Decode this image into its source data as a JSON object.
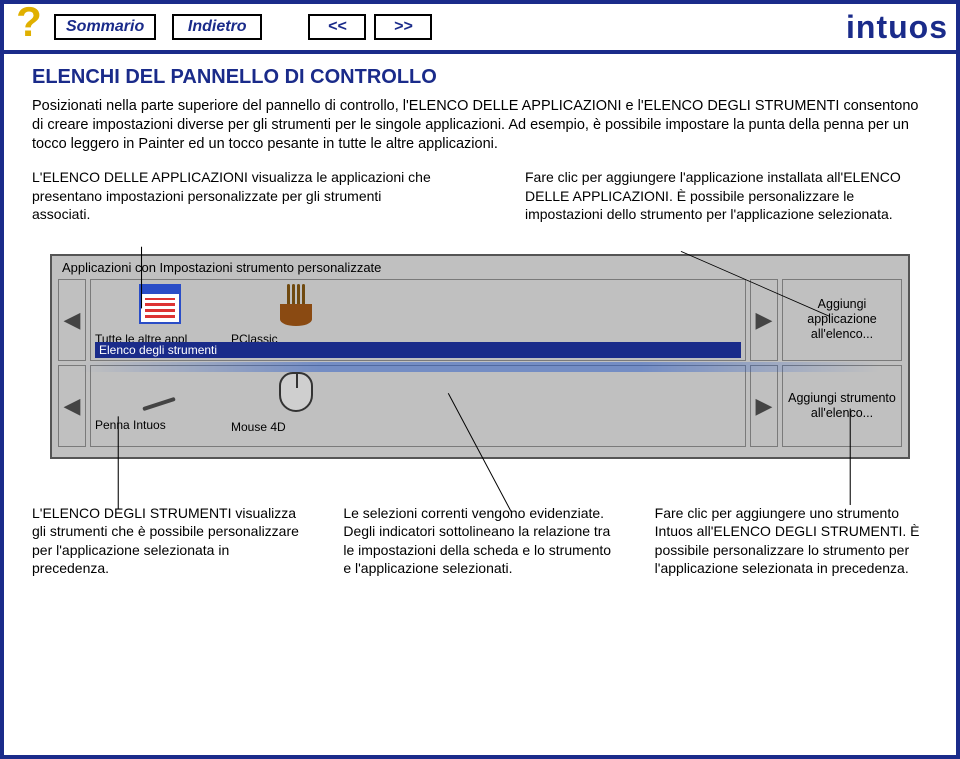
{
  "nav": {
    "summary": "Sommario",
    "back": "Indietro",
    "prev": "<<",
    "next": ">>"
  },
  "brand": "intuos",
  "title": "ELENCHI DEL PANNELLO DI CONTROLLO",
  "intro_before": "Posizionati nella parte superiore del pannello di controllo, l'",
  "intro_sc1": "ELENCO DELLE APPLICAZIONI",
  "intro_mid1": " e l'",
  "intro_sc2": "ELENCO DEGLI STRUMENTI",
  "intro_after": " consentono di creare impostazioni diverse per gli strumenti per le singole applicazioni. Ad esempio, è possibile impostare la punta della penna per un tocco leggero in Painter ed un tocco pesante in tutte le altre applicazioni.",
  "left_col_pre": "L'",
  "left_col_sc": "ELENCO DELLE APPLICAZIONI",
  "left_col_post": " visualizza le applicazioni che presentano impostazioni personalizzate per gli strumenti associati.",
  "right_col_pre": "Fare clic per aggiungere l'applicazione installata all'",
  "right_col_sc": "ELENCO DELLE APPLICAZIONI",
  "right_col_post": ". È possibile personalizzare le impostazioni dello strumento per l'applicazione selezionata.",
  "panel": {
    "title": "Applicazioni con Impostazioni strumento personalizzate",
    "apps": [
      {
        "label": "Tutte le altre appl"
      },
      {
        "label": "PClassic"
      }
    ],
    "sel_apps_label": "Elenco degli strumenti",
    "tools": [
      {
        "label": "Penna Intuos"
      },
      {
        "label": "Mouse 4D"
      }
    ],
    "add_app": "Aggiungi applicazione all'elenco...",
    "add_tool": "Aggiungi strumento all'elenco..."
  },
  "bottom": {
    "c1_pre": "L'",
    "c1_sc": "ELENCO DEGLI STRUMENTI",
    "c1_post": " visualizza gli strumenti che è possibile personalizzare per l'applicazione selezionata in precedenza.",
    "c2": "Le selezioni correnti vengono evidenziate. Degli indicatori sottolineano la relazione tra le impostazioni della scheda e lo strumento e l'applicazione selezionati.",
    "c3_pre": "Fare clic per aggiungere uno strumento Intuos all'",
    "c3_sc": "ELENCO DEGLI STRUMENTI",
    "c3_post": ". È possibile personalizzare lo strumento per l'applicazione selezionata in precedenza."
  }
}
